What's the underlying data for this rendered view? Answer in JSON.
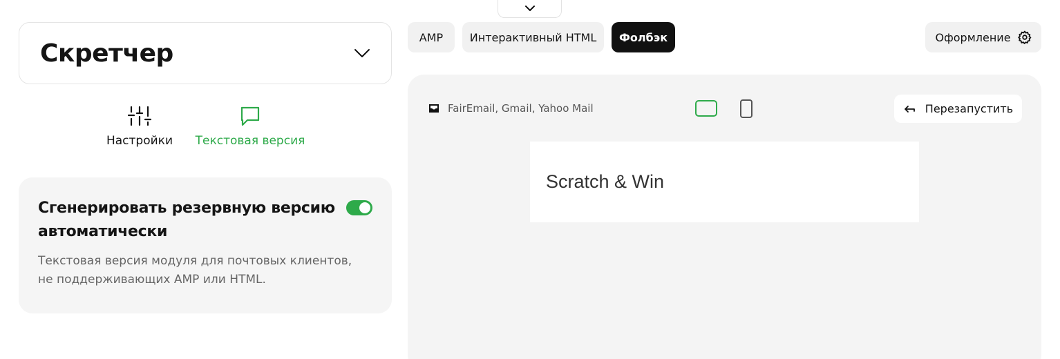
{
  "header": {
    "collapse_icon": "chevron-down-icon"
  },
  "module": {
    "title": "Скретчер",
    "dropdown_icon": "chevron-down-icon"
  },
  "mode_tabs": [
    {
      "label": "Настройки",
      "icon": "sliders-icon",
      "active": false
    },
    {
      "label": "Текстовая версия",
      "icon": "chat-bubble-icon",
      "active": true
    }
  ],
  "fallback_card": {
    "title": "Сгенерировать резервную версию автоматически",
    "description": "Текстовая версия модуля для почтовых клиентов, не поддерживающих AMP или HTML.",
    "toggle_on": true
  },
  "version_tabs": [
    {
      "label": "AMP",
      "active": false
    },
    {
      "label": "Интерактивный HTML",
      "active": false
    },
    {
      "label": "Фолбэк",
      "active": true
    }
  ],
  "design_button": {
    "label": "Оформление",
    "icon": "gear-icon"
  },
  "preview": {
    "clients_text": "FairEmail, Gmail, Yahoo Mail",
    "clients_icon": "inbox-icon",
    "device_active": "desktop",
    "restart_label": "Перезапустить",
    "restart_icon": "arrow-left-icon",
    "email_text": "Scratch & Win"
  },
  "colors": {
    "accent": "#2eaa4a",
    "active_tab_bg": "#111111",
    "panel_bg": "#f4f4f4"
  }
}
